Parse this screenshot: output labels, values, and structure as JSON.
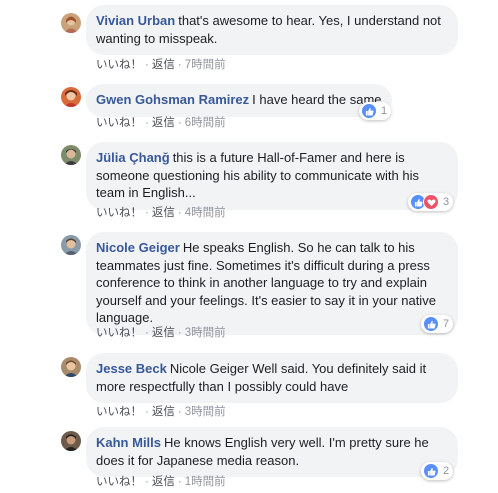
{
  "comments": [
    {
      "author": "Vivian Urban",
      "text": "that's awesome to hear. Yes, I understand not wanting to misspeak.",
      "like": "いいね！",
      "reply": "返信",
      "time": "7時間前",
      "reactions": null
    },
    {
      "author": "Gwen Gohsman Ramirez",
      "text": "I have heard the same",
      "like": "いいね！",
      "reply": "返信",
      "time": "6時間前",
      "reactions": {
        "types": [
          "like"
        ],
        "count": "1"
      }
    },
    {
      "author": "Jülia Çhanğ",
      "text": "this is a future Hall-of-Famer and here is someone questioning his ability to communicate with his team in English...",
      "like": "いいね！",
      "reply": "返信",
      "time": "4時間前",
      "reactions": {
        "types": [
          "like",
          "love"
        ],
        "count": "3"
      }
    },
    {
      "author": "Nicole Geiger",
      "text": "He speaks English. So he can talk to his teammates just fine. Sometimes it's difficult during a press conference to think in another language to try and explain yourself and your feelings. It's easier to say it in your native language.",
      "like": "いいね！",
      "reply": "返信",
      "time": "3時間前",
      "reactions": {
        "types": [
          "like"
        ],
        "count": "7"
      }
    },
    {
      "author": "Jesse Beck",
      "text": "Nicole Geiger Well said. You definitely said it more respectfully than I possibly could have",
      "like": "いいね！",
      "reply": "返信",
      "time": "3時間前",
      "reactions": null
    },
    {
      "author": "Kahn Mills",
      "text": "He knows English very well. I'm pretty sure he does it for Japanese media reason.",
      "like": "いいね！",
      "reply": "返信",
      "time": "1時間前",
      "reactions": {
        "types": [
          "like"
        ],
        "count": "2"
      }
    }
  ],
  "colors": {
    "author": "#385898",
    "bubble": "#f2f3f5",
    "meta": "#90949c",
    "like_reaction": "#5890ff",
    "love_reaction": "#f25268"
  }
}
